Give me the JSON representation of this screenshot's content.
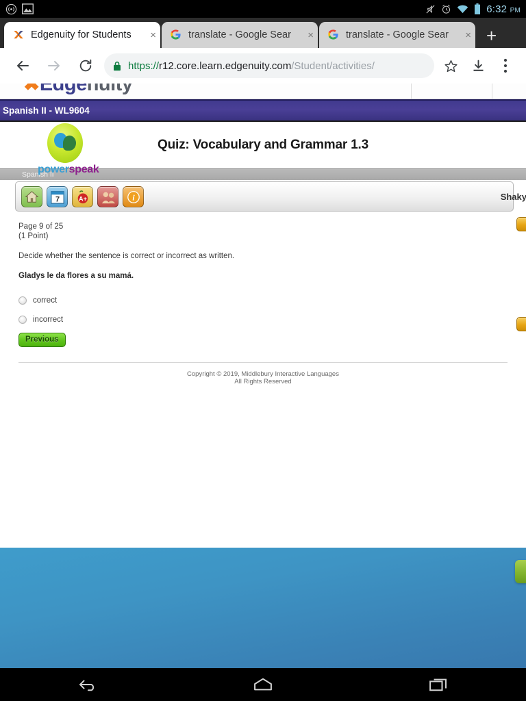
{
  "status_bar": {
    "notifications": [
      {
        "name": "cast-icon",
        "glyph": "cast"
      },
      {
        "name": "screenshot-image-icon",
        "glyph": "image"
      }
    ],
    "mute_icon": "mute-icon",
    "alarm_icon": "alarm-icon",
    "wifi_icon": "wifi-icon",
    "battery_icon": "battery-icon",
    "time": "6:32",
    "ampm": "PM"
  },
  "browser": {
    "tabs": [
      {
        "title": "Edgenuity for Students",
        "favicon": "edgenuity-x-icon",
        "active": true,
        "close": "×"
      },
      {
        "title": "translate - Google Sear",
        "favicon": "google-g-icon",
        "active": false,
        "close": "×"
      },
      {
        "title": "translate - Google Sear",
        "favicon": "google-g-icon",
        "active": false,
        "close": "×"
      }
    ],
    "new_tab_label": "+",
    "toolbar": {
      "back_icon": "back-arrow-icon",
      "forward_icon": "forward-arrow-icon",
      "reload_icon": "reload-icon",
      "lock_icon": "lock-icon",
      "bookmark_icon": "star-icon",
      "download_icon": "download-icon",
      "menu_icon": "three-dot-menu-icon"
    },
    "url": {
      "scheme": "https://",
      "host": "r12.core.learn.edgenuity.com",
      "path": "/Student/activities/"
    }
  },
  "page": {
    "brand": {
      "x": "✖",
      "word_e": "Edge",
      "word_g": "nuity"
    },
    "course_bar": {
      "label": "Spanish II - WL9604"
    },
    "lesson_header": {
      "logo_word_1": "power",
      "logo_word_2": "speak",
      "title": "Quiz: Vocabulary and Grammar 1.3"
    },
    "sub_bar": {
      "label": "Spanish II"
    },
    "toolbar": {
      "icons": [
        {
          "name": "home-icon",
          "glyph": "⌂",
          "color": "#7fbf4f"
        },
        {
          "name": "calendar-icon",
          "glyph": "7",
          "color": "#4d9fd4"
        },
        {
          "name": "grades-apple-icon",
          "glyph": "A+",
          "color": "#e0b53c"
        },
        {
          "name": "people-icon",
          "glyph": "👥",
          "color": "#c04a44"
        },
        {
          "name": "info-icon",
          "glyph": "i",
          "color": "#e08a14"
        }
      ],
      "user_label": "Shaky"
    },
    "quiz": {
      "page_indicator": "Page 9 of 25",
      "points": "(1 Point)",
      "instruction": "Decide whether the sentence is correct or incorrect as written.",
      "sentence": "Gladys le da flores a su mamá.",
      "choices": [
        {
          "label": "correct",
          "selected": false
        },
        {
          "label": "incorrect",
          "selected": false
        }
      ],
      "previous_button": "Previous",
      "edge_buttons": [
        {
          "name": "next-button-top",
          "color": "#e7a515"
        },
        {
          "name": "next-button-bottom",
          "color": "#e7a515"
        }
      ]
    },
    "footer": {
      "line1": "Copyright © 2019, Middlebury Interactive Languages",
      "line2": "All Rights Reserved"
    }
  },
  "wallpaper": {
    "chip_color": "#7fb22c"
  },
  "nav_bar": {
    "back": "back-nav-icon",
    "home": "home-nav-icon",
    "recents": "recents-nav-icon"
  }
}
